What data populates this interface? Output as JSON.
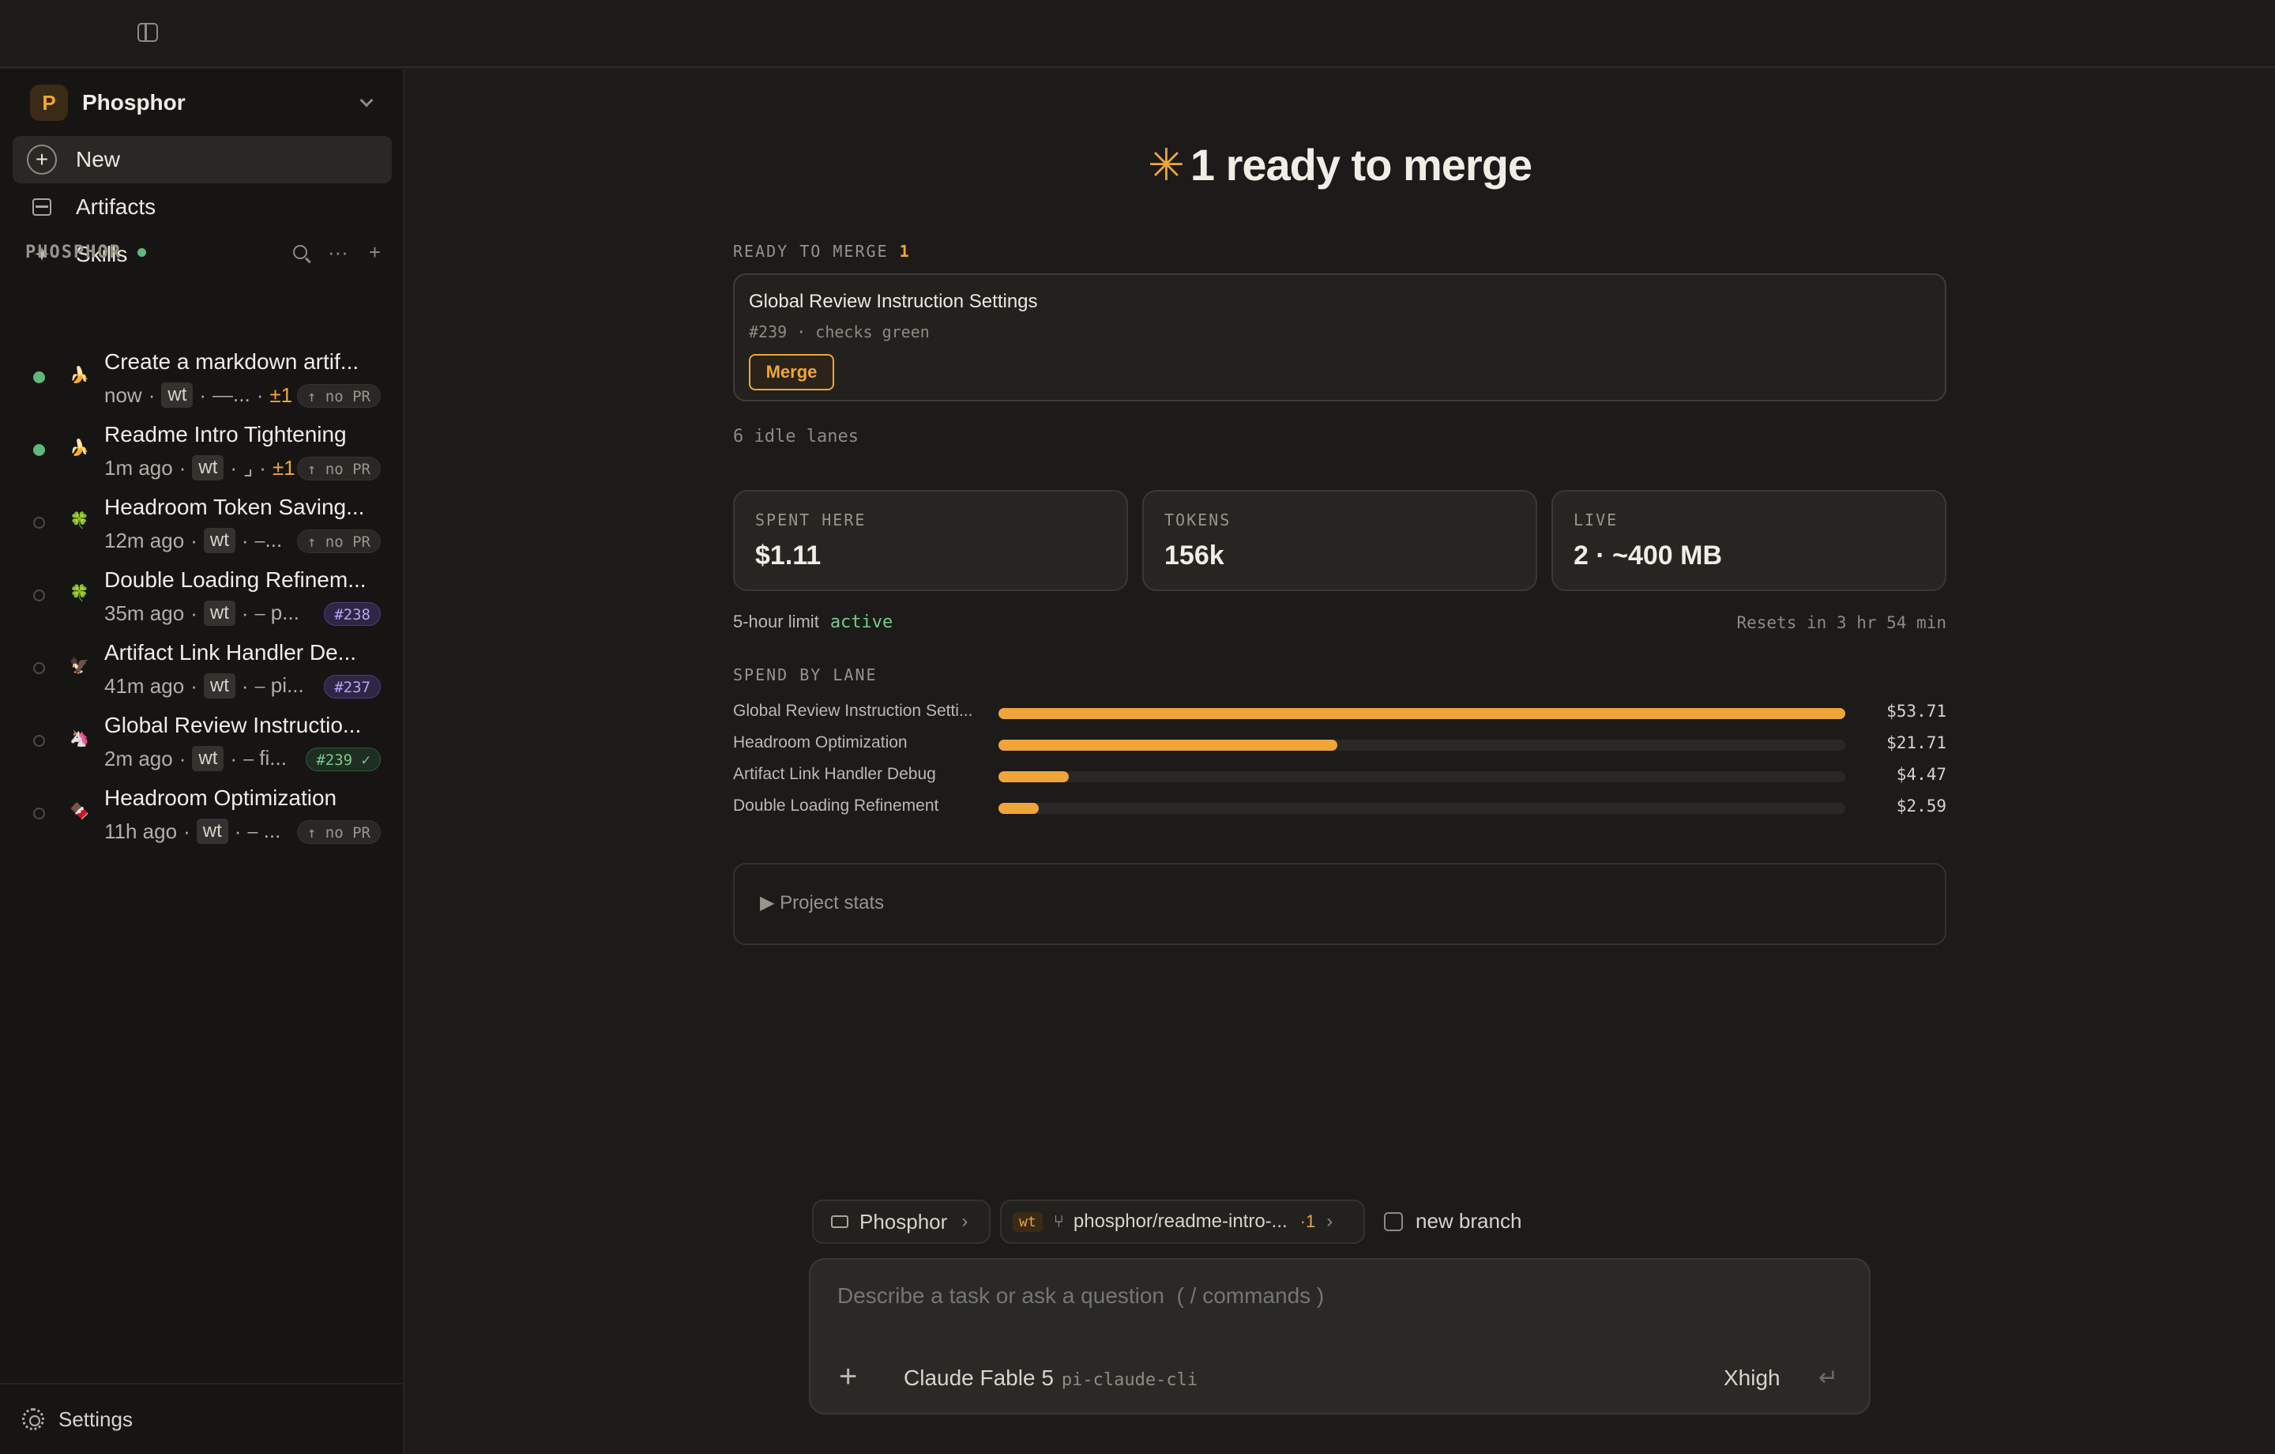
{
  "sidebar": {
    "project": {
      "avatar_letter": "P",
      "name": "Phosphor"
    },
    "nav": [
      {
        "label": "New",
        "icon": "plus-circle-icon"
      },
      {
        "label": "Artifacts",
        "icon": "artifacts-icon"
      },
      {
        "label": "Skills",
        "icon": "sparkle-icon"
      }
    ],
    "section": {
      "title": "PHOSPHOR",
      "more": "···",
      "add": "+"
    },
    "lanes": [
      {
        "emoji": "🍌",
        "title": "Create a markdown artif...",
        "time": "now",
        "wt": "wt",
        "branch": "⎯⎯...",
        "delta": "±1",
        "pr": "↑ no PR"
      },
      {
        "emoji": "🍌",
        "title": "Readme Intro Tightening",
        "time": "1m ago",
        "wt": "wt",
        "branch": "⌟",
        "delta": "±1",
        "pr": "↑ no PR"
      },
      {
        "emoji": "🍀",
        "title": "Headroom Token Saving...",
        "time": "12m ago",
        "wt": "wt",
        "branch": "⎯...",
        "delta": "",
        "pr": "↑ no PR"
      },
      {
        "emoji": "🍀",
        "title": "Double Loading Refinem...",
        "time": "35m ago",
        "wt": "wt",
        "branch": "⎯ p...",
        "delta": "",
        "pr": "#238"
      },
      {
        "emoji": "🦅",
        "title": "Artifact Link Handler De...",
        "time": "41m ago",
        "wt": "wt",
        "branch": "⎯ pi...",
        "delta": "",
        "pr": "#237"
      },
      {
        "emoji": "🦄",
        "title": "Global Review Instructio...",
        "time": "2m ago",
        "wt": "wt",
        "branch": "⎯ fi...",
        "delta": "",
        "pr": "#239 ✓"
      },
      {
        "emoji": "🍫",
        "title": "Headroom Optimization",
        "time": "11h ago",
        "wt": "wt",
        "branch": "⎯ ...",
        "delta": "",
        "pr": "↑ no PR"
      }
    ],
    "settings_label": "Settings"
  },
  "main": {
    "headline_star": "✳",
    "headline": "1 ready to merge",
    "ready_label": "READY TO MERGE",
    "ready_count": "1",
    "merge_card": {
      "title": "Global Review Instruction Settings",
      "sub": "#239 · checks green",
      "button": "Merge"
    },
    "idle_lanes": "6 idle lanes",
    "stats": [
      {
        "label": "SPENT HERE",
        "value": "$1.11"
      },
      {
        "label": "TOKENS",
        "value": "156k"
      },
      {
        "label": "LIVE",
        "value": "2 · ~400 MB"
      }
    ],
    "limit_label": "5-hour limit",
    "limit_status": "active",
    "resets": "Resets in 3 hr 54 min",
    "spend_label": "SPEND BY LANE",
    "spend": [
      {
        "name": "Global Review Instruction Setti...",
        "value": "$53.71",
        "fraction": 1.0
      },
      {
        "name": "Headroom Optimization",
        "value": "$21.71",
        "fraction": 0.4
      },
      {
        "name": "Artifact Link Handler Debug",
        "value": "$4.47",
        "fraction": 0.083
      },
      {
        "name": "Double Loading Refinement",
        "value": "$2.59",
        "fraction": 0.048
      }
    ],
    "project_stats": "▶ Project stats"
  },
  "composer": {
    "project_chip": "Phosphor",
    "branch_tag": "wt",
    "branch": "phosphor/readme-intro-...",
    "branch_delta": "·1",
    "new_branch": "new branch",
    "placeholder": "Describe a task or ask a question  ( / commands )",
    "model": "Claude Fable 5",
    "provider": "pi-claude-cli",
    "effort": "Xhigh",
    "send_icon": "↵"
  },
  "colors": {
    "accent": "#f0a53a",
    "status_green": "#5db87a",
    "background": "#1c1b19",
    "sidebar": "#161514"
  }
}
